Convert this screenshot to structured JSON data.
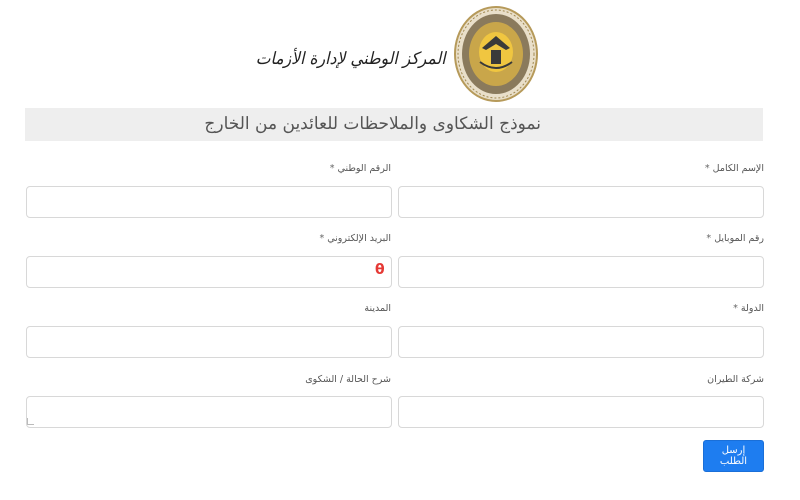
{
  "header": {
    "logo_text": "المركز الوطني لإدارة الأزمات"
  },
  "form": {
    "title": "نموذج الشكاوى والملاحظات للعائدين من الخارج",
    "fields": [
      {
        "label": "الإسم الكامل",
        "required": true,
        "value": ""
      },
      {
        "label": "الرقم الوطني",
        "required": true,
        "value": ""
      },
      {
        "label": "رقم الموبايل",
        "required": true,
        "value": ""
      },
      {
        "label": "البريد الإلكتروني",
        "required": true,
        "value": ""
      },
      {
        "label": "الدولة",
        "required": true,
        "value": ""
      },
      {
        "label": "المدينة",
        "required": false,
        "value": ""
      },
      {
        "label": "شركة الطيران",
        "required": false,
        "value": ""
      },
      {
        "label": "شرح الحالة / الشكوى",
        "required": false,
        "value": ""
      }
    ],
    "required_mark": "*",
    "email_icon_glyph": "θ",
    "submit_label": "إرسل الطلب"
  },
  "colors": {
    "submit_bg": "#1e7df0",
    "title_bar_bg": "#eeeeee",
    "email_icon": "#e53935",
    "emblem_gold": "#c9a64a"
  }
}
